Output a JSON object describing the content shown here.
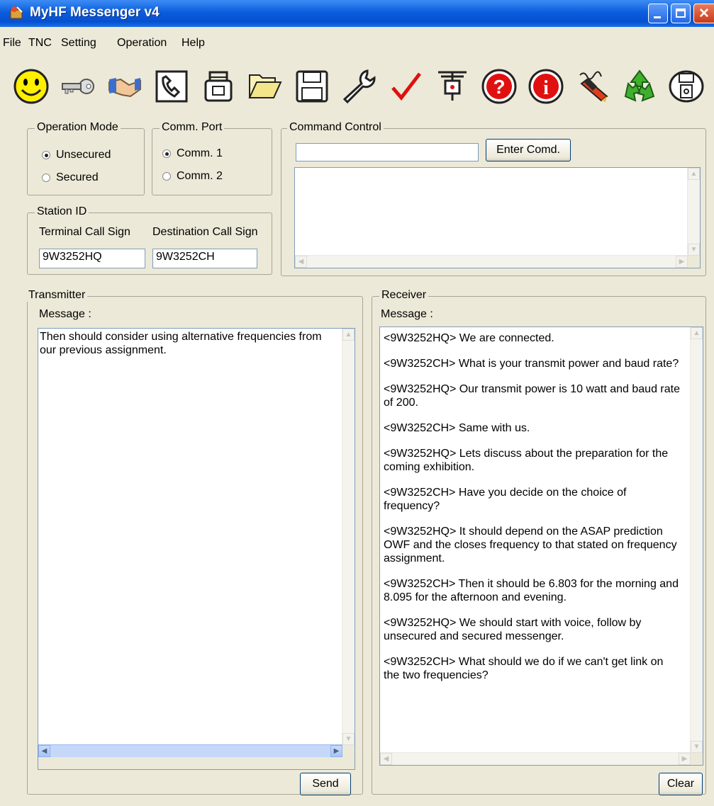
{
  "window": {
    "title": "MyHF Messenger v4"
  },
  "menu": [
    "File",
    "TNC",
    "Setting",
    "Operation",
    "Help"
  ],
  "toolbar": [
    {
      "name": "smiley-icon"
    },
    {
      "name": "key-icon"
    },
    {
      "name": "handshake-icon"
    },
    {
      "name": "phone-icon"
    },
    {
      "name": "fax-icon"
    },
    {
      "name": "folder-icon"
    },
    {
      "name": "floppy-disk-icon"
    },
    {
      "name": "wrench-icon"
    },
    {
      "name": "checkmark-icon"
    },
    {
      "name": "antenna-icon"
    },
    {
      "name": "help-icon"
    },
    {
      "name": "info-icon"
    },
    {
      "name": "signal-pen-icon"
    },
    {
      "name": "recycle-icon"
    },
    {
      "name": "device-icon"
    }
  ],
  "operation_mode": {
    "legend": "Operation Mode",
    "options": [
      "Unsecured",
      "Secured"
    ],
    "selected": "Unsecured"
  },
  "comm_port": {
    "legend": "Comm. Port",
    "options": [
      "Comm. 1",
      "Comm. 2"
    ],
    "selected": "Comm. 1"
  },
  "command_control": {
    "legend": "Command Control",
    "input_value": "",
    "button_label": "Enter Comd.",
    "output": ""
  },
  "station_id": {
    "legend": "Station ID",
    "terminal_label": "Terminal Call Sign",
    "terminal_value": "9W3252HQ",
    "destination_label": "Destination Call Sign",
    "destination_value": "9W3252CH"
  },
  "transmitter": {
    "legend": "Transmitter",
    "message_label": "Message :",
    "message": "Then should consider using alternative frequencies from our previous assignment.",
    "send_label": "Send"
  },
  "receiver": {
    "legend": "Receiver",
    "message_label": "Message :",
    "messages": [
      "<9W3252HQ> We are connected.",
      "<9W3252CH> What is your transmit power and baud rate?",
      "<9W3252HQ> Our transmit power is 10 watt and baud rate of 200.",
      "<9W3252CH> Same with us.",
      "<9W3252HQ> Lets discuss about the preparation for the coming exhibition.",
      "<9W3252CH> Have you decide on the choice of frequency?",
      "<9W3252HQ> It should depend on the ASAP prediction OWF and the closes frequency to that stated on frequency assignment.",
      "<9W3252CH> Then it should be 6.803 for the morning and 8.095 for the afternoon and evening.",
      "<9W3252HQ> We should start with voice, follow by unsecured and secured messenger.",
      "<9W3252CH> What should we do if we can't get link on the two frequencies?"
    ],
    "clear_label": "Clear"
  }
}
